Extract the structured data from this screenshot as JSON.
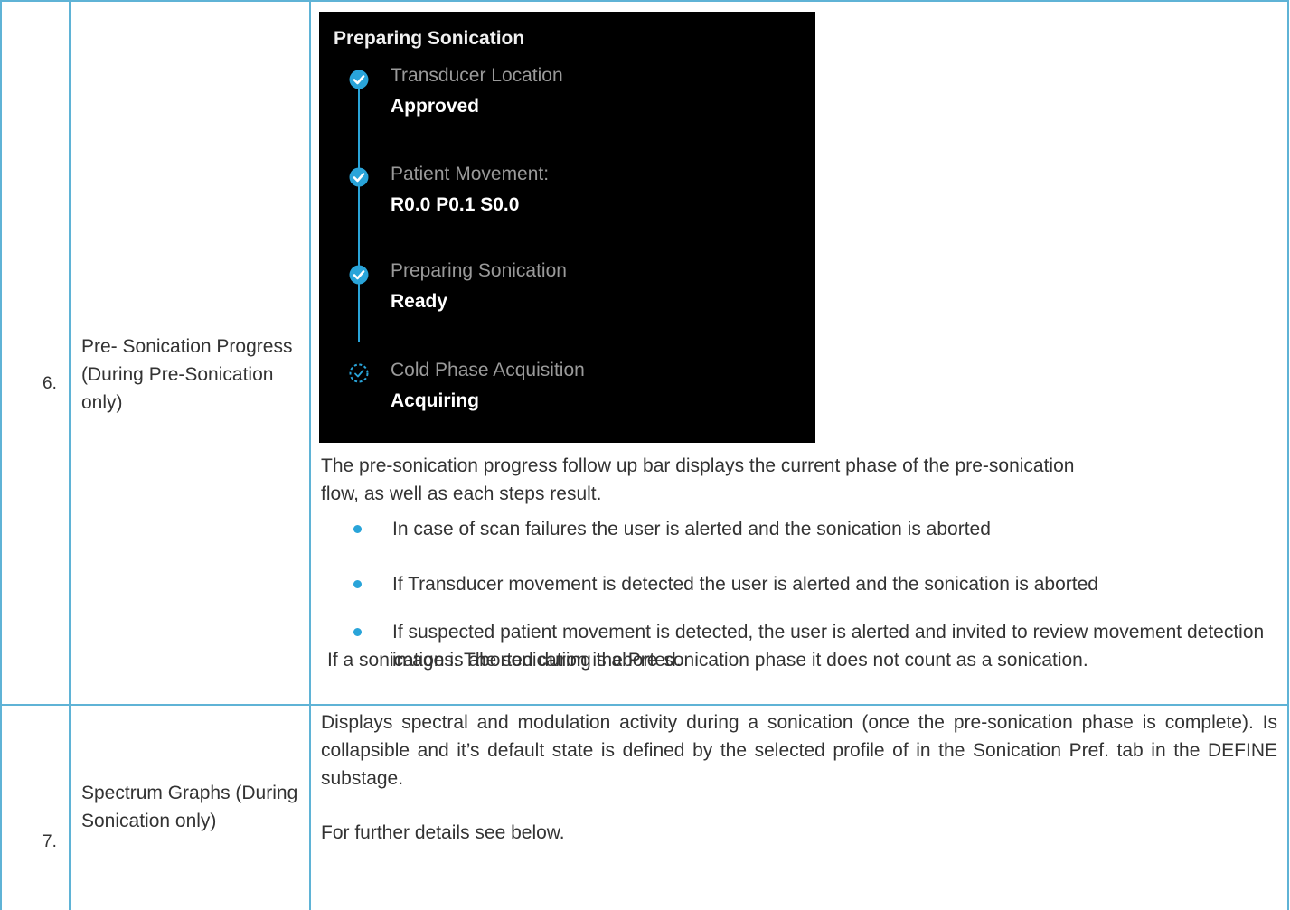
{
  "rows": [
    {
      "number": "6.",
      "title": "Pre- Sonication Progress (During Pre-Sonication only)",
      "panel": {
        "title": "Preparing Sonication",
        "steps": [
          {
            "label": "Transducer Location",
            "value": "Approved",
            "status": "complete",
            "icon": "check-circle-icon"
          },
          {
            "label": "Patient Movement:",
            "value": "R0.0 P0.1 S0.0",
            "status": "complete",
            "icon": "check-circle-icon"
          },
          {
            "label": "Preparing Sonication",
            "value": "Ready",
            "status": "complete",
            "icon": "check-circle-icon"
          },
          {
            "label": "Cold Phase Acquisition",
            "value": "Acquiring",
            "status": "in-progress",
            "icon": "dashed-check-circle-icon"
          }
        ],
        "accent_color": "#29a4d9"
      },
      "description": "The pre-sonication progress follow up bar displays the current phase of the pre-sonication flow, as well as each steps result.",
      "bullets": [
        "In case of scan failures the user is alerted and the sonication is aborted",
        "If Transducer movement is detected the user is alerted and the sonication is aborted",
        "If suspected patient movement is detected, the user is alerted and invited to review movement detection images. The sonication is aborted."
      ],
      "note": "If a sonication is aborted during the Pre-sonication phase it does not count as a sonication."
    },
    {
      "number": "7.",
      "title": "Spectrum Graphs (During Sonication only)",
      "description": "Displays spectral and modulation activity during a sonication (once the pre-sonication phase is complete). Is collapsible and it’s default state is defined by the selected profile of in the Sonication Pref. tab in the DEFINE substage.",
      "note": "For further details see below."
    }
  ],
  "border_color": "#5fb3d6"
}
